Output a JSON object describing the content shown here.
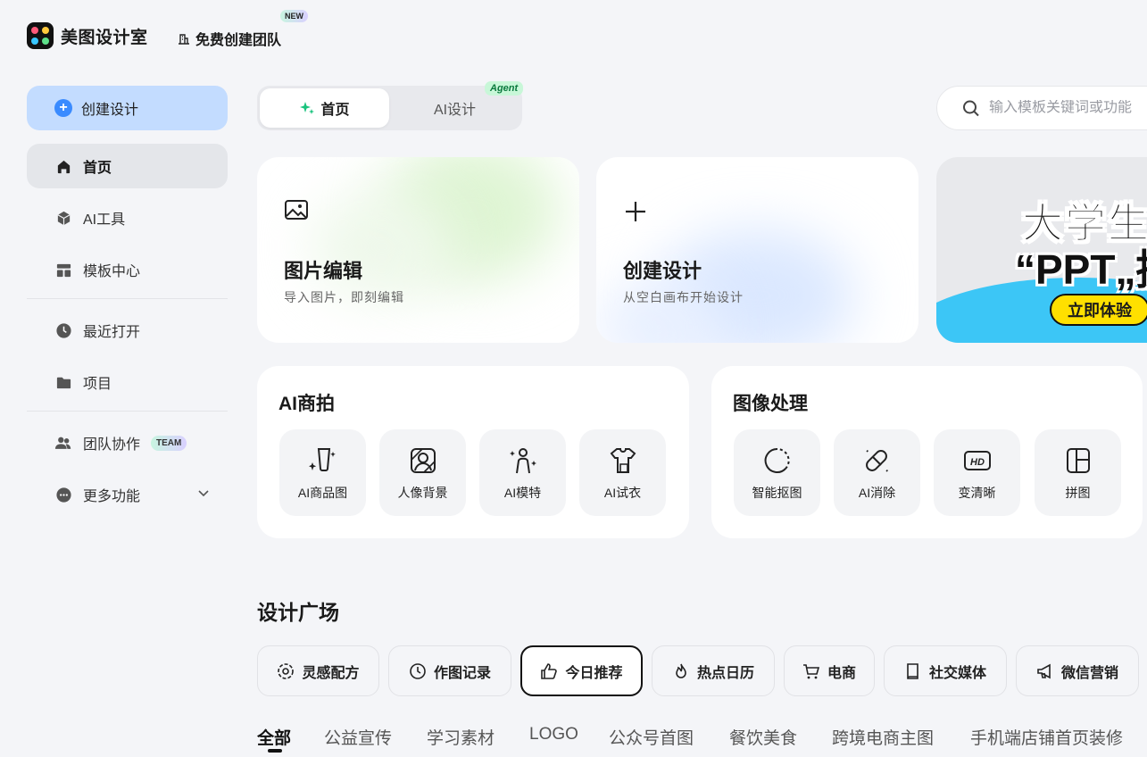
{
  "brand": {
    "name": "美图设计室"
  },
  "top": {
    "team_link": "免费创建团队",
    "new_badge": "NEW"
  },
  "sidebar": {
    "create_label": "创建设计",
    "items": [
      {
        "label": "首页",
        "icon": "home-icon"
      },
      {
        "label": "AI工具",
        "icon": "cube-icon"
      },
      {
        "label": "模板中心",
        "icon": "template-icon"
      },
      {
        "label": "最近打开",
        "icon": "clock-icon"
      },
      {
        "label": "项目",
        "icon": "folder-icon"
      },
      {
        "label": "团队协作",
        "icon": "team-icon",
        "badge": "TEAM"
      },
      {
        "label": "更多功能",
        "icon": "more-icon"
      }
    ]
  },
  "tabs": {
    "home": "首页",
    "ai": "AI设计",
    "agent_badge": "Agent"
  },
  "search": {
    "placeholder": "输入模板关键词或功能"
  },
  "cards": [
    {
      "title": "图片编辑",
      "subtitle": "导入图片，即刻编辑"
    },
    {
      "title": "创建设计",
      "subtitle": "从空白画布开始设计"
    }
  ],
  "banner": {
    "line1": "大学生",
    "line2": "“PPT„挑",
    "cta": "立即体验"
  },
  "panels": [
    {
      "title": "AI商拍",
      "tools": [
        "AI商品图",
        "人像背景",
        "AI模特",
        "AI试衣"
      ]
    },
    {
      "title": "图像处理",
      "tools": [
        "智能抠图",
        "AI消除",
        "变清晰",
        "拼图"
      ]
    }
  ],
  "square": {
    "title": "设计广场",
    "chips": [
      "灵感配方",
      "作图记录",
      "今日推荐",
      "热点日历",
      "电商",
      "社交媒体",
      "微信营销"
    ],
    "categories": [
      "全部",
      "公益宣传",
      "学习素材",
      "LOGO",
      "公众号首图",
      "餐饮美食",
      "跨境电商主图",
      "手机端店铺首页装修"
    ]
  }
}
